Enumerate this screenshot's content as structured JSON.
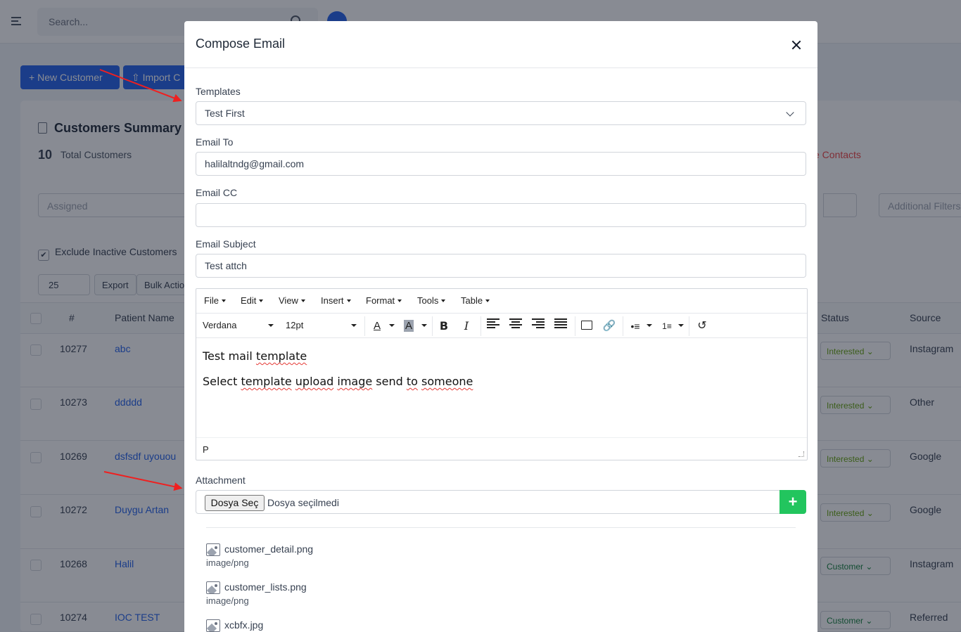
{
  "background": {
    "search_placeholder": "Search...",
    "new_customer_label": "New Customer",
    "import_label": "Import C",
    "summary_title": "Customers Summary",
    "total_count": "10",
    "total_label": "Total Customers",
    "inactive_contacts": "ve Contacts",
    "assigned_placeholder": "Assigned",
    "additional_filters": "Additional Filters",
    "exclude_inactive": "Exclude Inactive Customers",
    "page_size": "25",
    "export_label": "Export",
    "bulk_label": "Bulk Actio",
    "columns": {
      "id": "#",
      "name": "Patient Name",
      "status": "Status",
      "source": "Source"
    },
    "rows": [
      {
        "id": "10277",
        "name": "abc",
        "status": "Interested",
        "source": "Instagram"
      },
      {
        "id": "10273",
        "name": "ddddd",
        "status": "Interested",
        "source": "Other"
      },
      {
        "id": "10269",
        "name": "dsfsdf uyouou",
        "status": "Interested",
        "source": "Google"
      },
      {
        "id": "10272",
        "name": "Duygu Artan",
        "status": "Interested",
        "source": "Google"
      },
      {
        "id": "10268",
        "name": "Halil",
        "status": "Customer",
        "source": "Instagram"
      },
      {
        "id": "10274",
        "name": "IOC TEST",
        "status": "Customer",
        "source": "Referred"
      }
    ]
  },
  "modal": {
    "title": "Compose Email",
    "templates_label": "Templates",
    "template_value": "Test First",
    "email_to_label": "Email To",
    "email_to_value": "halilaltndg@gmail.com",
    "email_cc_label": "Email CC",
    "email_cc_value": "",
    "subject_label": "Email Subject",
    "subject_value": "Test attch",
    "editor": {
      "menu": [
        "File",
        "Edit",
        "View",
        "Insert",
        "Format",
        "Tools",
        "Table"
      ],
      "font_family": "Verdana",
      "font_size": "12pt",
      "body_line1_plain": "Test mail ",
      "body_line1_sq": "template",
      "body_line2_a": "Select ",
      "body_line2_b": "template",
      "body_line2_c": " ",
      "body_line2_d": "upload",
      "body_line2_e": " ",
      "body_line2_f": "image",
      "body_line2_g": " send ",
      "body_line2_h": "to",
      "body_line2_i": " ",
      "body_line2_j": "someone",
      "statusbar_path": "P"
    },
    "attachment_label": "Attachment",
    "file_button": "Dosya Seç",
    "file_none": "Dosya seçilmedi",
    "add_button": "+",
    "attachments": [
      {
        "name": "customer_detail.png",
        "type": "image/png"
      },
      {
        "name": "customer_lists.png",
        "type": "image/png"
      },
      {
        "name": "xcbfx.jpg",
        "type": ""
      }
    ]
  },
  "colors": {
    "primary": "#2563eb",
    "success": "#22c55e",
    "annotation_arrow": "#ef2020"
  }
}
